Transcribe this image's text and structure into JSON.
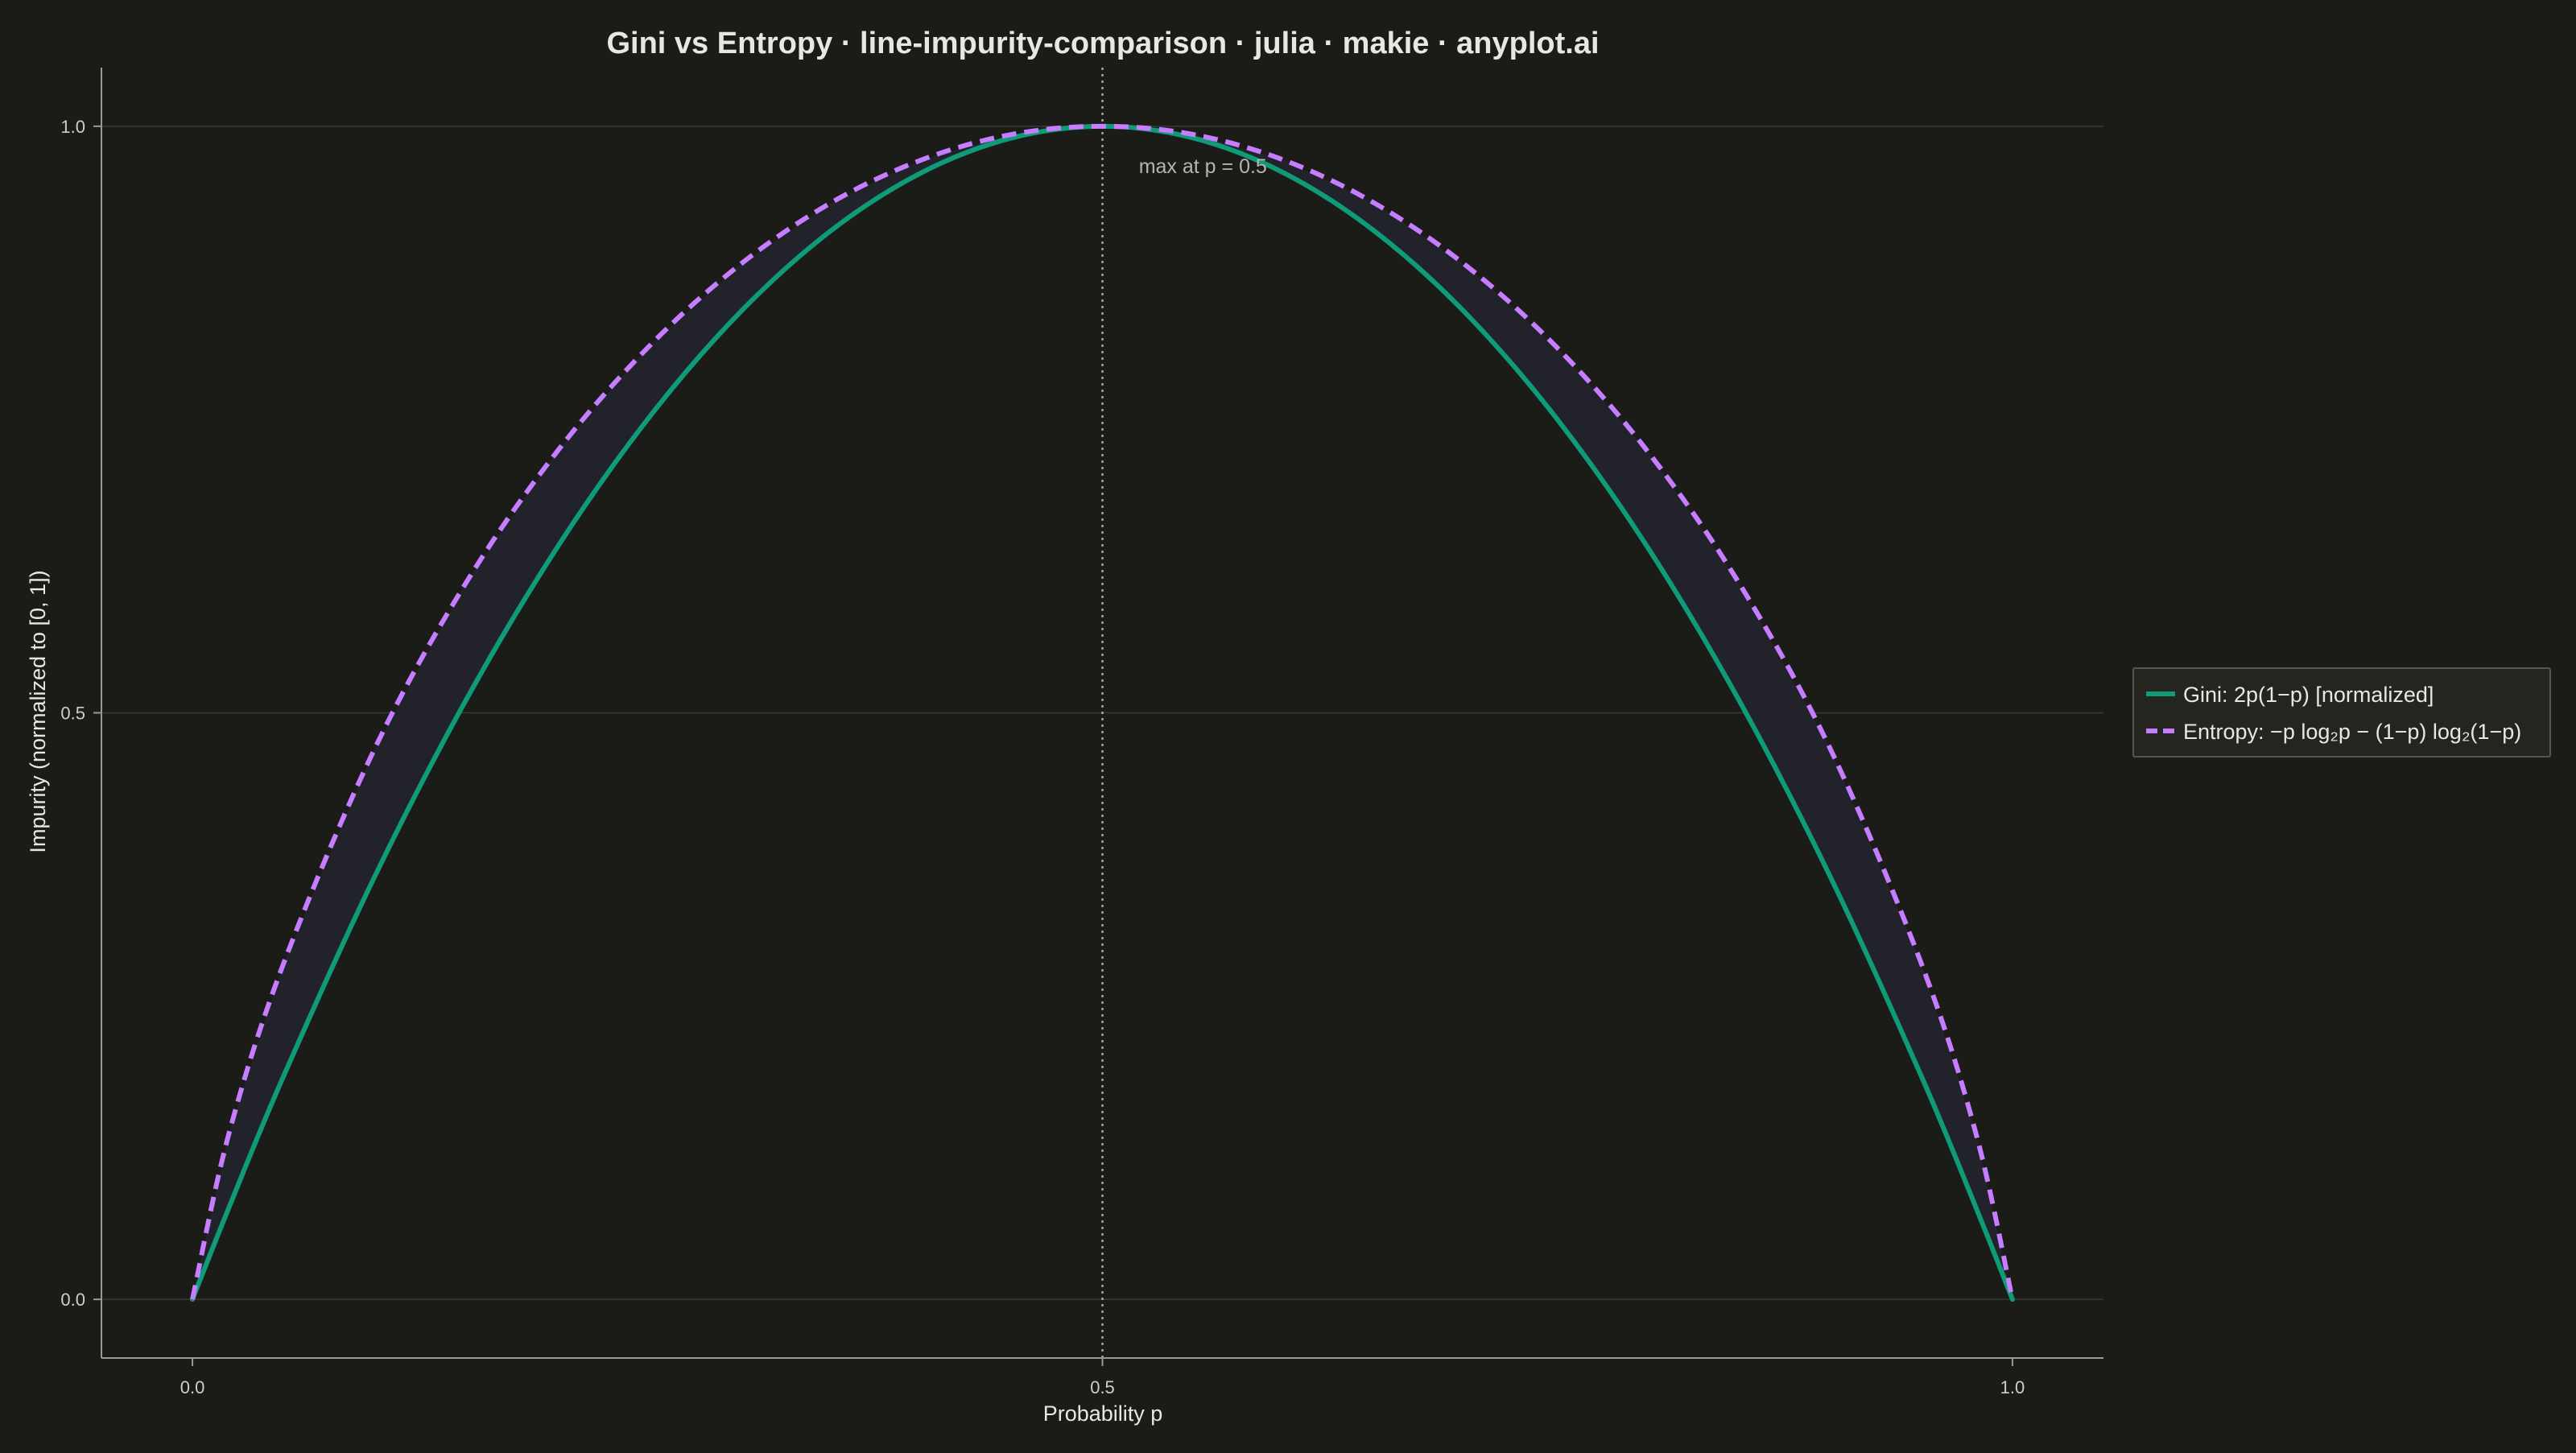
{
  "colors": {
    "background": "#1b1b17",
    "axis": "#9a9a94",
    "grid": "#3a3a35",
    "text": "#e8e8e2",
    "tick_text": "#cfcfc9",
    "annotation_text": "#b5b5ae",
    "gini": "#0f9b77",
    "entropy": "#c77dff",
    "fill": "#22232a",
    "vline": "#a8a8a2",
    "legend_bg": "#25251f",
    "legend_border": "#55554f"
  },
  "chart_data": {
    "type": "line",
    "title": "Gini vs Entropy · line-impurity-comparison · julia · makie · anyplot.ai",
    "xlabel": "Probability p",
    "ylabel": "Impurity (normalized to [0, 1])",
    "xlim": [
      -0.05,
      1.05
    ],
    "ylim": [
      -0.05,
      1.05
    ],
    "xticks": [
      0.0,
      0.5,
      1.0
    ],
    "xtick_labels": [
      "0.0",
      "0.5",
      "1.0"
    ],
    "yticks": [
      0.0,
      0.5,
      1.0
    ],
    "ytick_labels": [
      "0.0",
      "0.5",
      "1.0"
    ],
    "grid": "horizontal",
    "legend_position": "right",
    "vline": {
      "x": 0.5,
      "style": "dotted"
    },
    "annotation": {
      "text": "max at p = 0.5",
      "x": 0.52,
      "y": 0.96
    },
    "fill_between": [
      "gini",
      "entropy"
    ],
    "x": [
      0.0,
      0.02,
      0.05,
      0.1,
      0.15,
      0.2,
      0.25,
      0.3,
      0.35,
      0.4,
      0.45,
      0.5,
      0.55,
      0.6,
      0.65,
      0.7,
      0.75,
      0.8,
      0.85,
      0.9,
      0.95,
      0.98,
      1.0
    ],
    "series": [
      {
        "key": "gini",
        "name": "Gini:  2p(1−p)  [normalized]",
        "style": "solid",
        "values": [
          0.0,
          0.078,
          0.19,
          0.36,
          0.51,
          0.64,
          0.75,
          0.84,
          0.91,
          0.96,
          0.99,
          1.0,
          0.99,
          0.96,
          0.91,
          0.84,
          0.75,
          0.64,
          0.51,
          0.36,
          0.19,
          0.078,
          0.0
        ]
      },
      {
        "key": "entropy",
        "name": "Entropy:  −p log₂p − (1−p) log₂(1−p)",
        "style": "dashed",
        "values": [
          0.0,
          0.141,
          0.286,
          0.469,
          0.61,
          0.722,
          0.811,
          0.881,
          0.934,
          0.971,
          0.993,
          1.0,
          0.993,
          0.971,
          0.934,
          0.881,
          0.811,
          0.722,
          0.61,
          0.469,
          0.286,
          0.141,
          0.0
        ]
      }
    ]
  }
}
